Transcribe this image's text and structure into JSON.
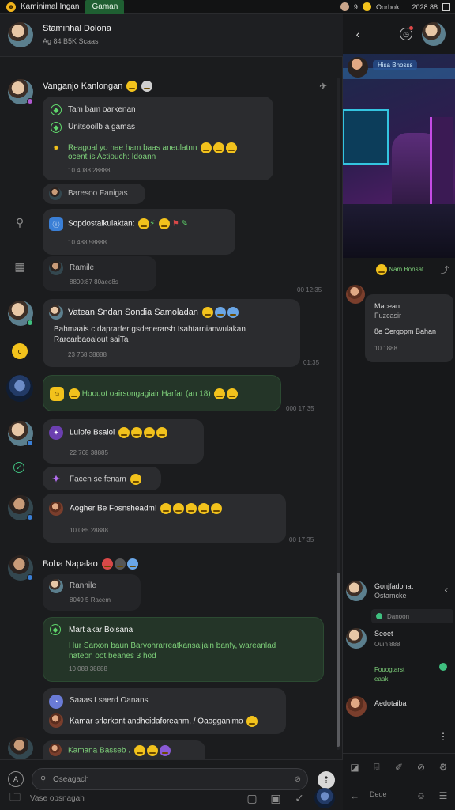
{
  "window": {
    "tabs": [
      {
        "label": "Kaminimal Ingan"
      },
      {
        "label": "Gaman"
      }
    ],
    "right_text_a": "9",
    "right_text_b": "Oorbok",
    "right_text_c": "2028 88"
  },
  "chat_header": {
    "title": "Staminhal Dolona",
    "subtitle": "Ag 84 B5K Scaas"
  },
  "messages": [
    {
      "id": "m1",
      "name": "Vanganjo Kanlongan",
      "lines": [
        "Tam bam oarkenan",
        "Unitsooilb a gamas"
      ],
      "green_lines": [
        "Reagoal yo hae ham baas aneulatnn",
        "ocent is Actiouch: Idoann"
      ],
      "time": "10 4088 28888"
    },
    {
      "id": "m2",
      "quote": "Baresoo Fanigas"
    },
    {
      "id": "m3",
      "text": "Sopdostalkulaktan:",
      "time": "10 488 58888"
    },
    {
      "id": "m4",
      "text": "Ramile",
      "time": "8800:87 80aeo8s"
    },
    {
      "id": "m5",
      "name": "Vatean Sndan Sondia Samoladan",
      "lines": [
        "Bahmaais c daprarfer gsdenerarsh Isahtarnianwulakan",
        "Rarcarbaoalout saiTa"
      ],
      "time": "23 768 38888",
      "side_time": "01:35"
    },
    {
      "id": "m6",
      "green_text": "Hoouot oairsongagiair Harfar (an 18)",
      "side_time": "000 17 35"
    },
    {
      "id": "m7",
      "text": "Lulofe Bsalol",
      "time": "22 768 38885"
    },
    {
      "id": "m8",
      "text": "Facen se fenam"
    },
    {
      "id": "m9",
      "text": "Aogher Be Fosnsheadm!",
      "time": "10 085 28888",
      "side_time": "00 17 35"
    },
    {
      "id": "m10",
      "name": "Boha Napalao",
      "quote": "Rannile",
      "time": "8049 5 Racem"
    },
    {
      "id": "m11",
      "title": "Mart akar Boisana",
      "green_lines": [
        "Hur Sarxon baun Barvohrarreatkansaijain banfy, wareanlad",
        "nateon oot beanes 3 hod"
      ],
      "time": "10 088 38888"
    },
    {
      "id": "m12",
      "lines": [
        "Saaas Lsaerd Oanans",
        "Kamar srlarkant andheidaforeanm, / Oaogganimo"
      ]
    },
    {
      "id": "m13",
      "text": "Kamana Basseb ."
    }
  ],
  "side_times": {
    "t1": "00 12:35"
  },
  "composer": {
    "placeholder": "Oseagach"
  },
  "bottom_nav": {
    "label": "Vase opsnagah"
  },
  "right_panel": {
    "pill": "Hisa Bhosss",
    "reaction": "Nam Bonsat",
    "card": {
      "title": "Macean",
      "sub": "Fuzcasir",
      "line": "8e Cergopm Bahan",
      "time": "10 1888"
    },
    "thread1": {
      "title": "Gonjfadonat",
      "sub": "Ostamcke"
    },
    "chip": "Danoon",
    "thread2": {
      "title": "Seoet",
      "sub": "Ouin 888"
    },
    "green_line": "Fouogtarst",
    "green_sub": "eaak",
    "thread3": {
      "title": "Aedotaiba"
    },
    "bottom_label": "Dede"
  },
  "colors": {
    "accent_green": "#1f5f32",
    "emoji_yellow": "#f2c21c",
    "bubble": "#2b2c2f"
  }
}
